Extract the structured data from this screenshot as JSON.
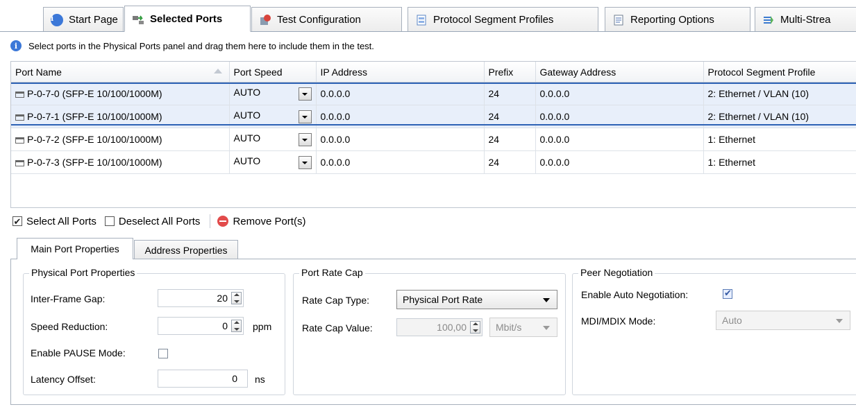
{
  "tabs": [
    {
      "label": "Start Page",
      "icon": "info-icon"
    },
    {
      "label": "Selected Ports",
      "icon": "selected-ports-icon",
      "active": true
    },
    {
      "label": "Test Configuration",
      "icon": "test-configuration-icon"
    },
    {
      "label": "Protocol Segment Profiles",
      "icon": "protocol-profiles-icon"
    },
    {
      "label": "Reporting Options",
      "icon": "reporting-options-icon"
    },
    {
      "label": "Multi-Strea",
      "icon": "multi-stream-icon"
    }
  ],
  "info_text": "Select ports in the Physical Ports panel and drag them here to include them in the test.",
  "grid": {
    "columns": [
      "Port Name",
      "Port Speed",
      "IP Address",
      "Prefix",
      "Gateway Address",
      "Protocol Segment Profile"
    ],
    "rows": [
      {
        "name": "P-0-7-0 (SFP-E 10/100/1000M)",
        "speed": "AUTO",
        "ip": "0.0.0.0",
        "prefix": "24",
        "gateway": "0.0.0.0",
        "profile": "2: Ethernet / VLAN (10)",
        "selected": true
      },
      {
        "name": "P-0-7-1 (SFP-E 10/100/1000M)",
        "speed": "AUTO",
        "ip": "0.0.0.0",
        "prefix": "24",
        "gateway": "0.0.0.0",
        "profile": "2: Ethernet / VLAN (10)",
        "selected": true
      },
      {
        "name": "P-0-7-2 (SFP-E 10/100/1000M)",
        "speed": "AUTO",
        "ip": "0.0.0.0",
        "prefix": "24",
        "gateway": "0.0.0.0",
        "profile": "1: Ethernet",
        "selected": false
      },
      {
        "name": "P-0-7-3 (SFP-E 10/100/1000M)",
        "speed": "AUTO",
        "ip": "0.0.0.0",
        "prefix": "24",
        "gateway": "0.0.0.0",
        "profile": "1: Ethernet",
        "selected": false
      }
    ]
  },
  "toolbar": {
    "select_all": "Select All Ports",
    "deselect_all": "Deselect All Ports",
    "remove": "Remove Port(s)"
  },
  "subtabs": {
    "main": "Main Port Properties",
    "address": "Address Properties"
  },
  "physical": {
    "title": "Physical Port Properties",
    "ifg_label": "Inter-Frame Gap:",
    "ifg_value": "20",
    "speed_red_label": "Speed Reduction:",
    "speed_red_value": "0",
    "speed_red_unit": "ppm",
    "pause_label": "Enable PAUSE Mode:",
    "latency_label": "Latency Offset:",
    "latency_value": "0",
    "latency_unit": "ns"
  },
  "ratecap": {
    "title": "Port Rate Cap",
    "type_label": "Rate Cap Type:",
    "type_value": "Physical Port Rate",
    "value_label": "Rate Cap Value:",
    "value": "100,00",
    "unit": "Mbit/s"
  },
  "peer": {
    "title": "Peer Negotiation",
    "auto_label": "Enable Auto Negotiation:",
    "mdi_label": "MDI/MDIX Mode:",
    "mdi_value": "Auto"
  }
}
